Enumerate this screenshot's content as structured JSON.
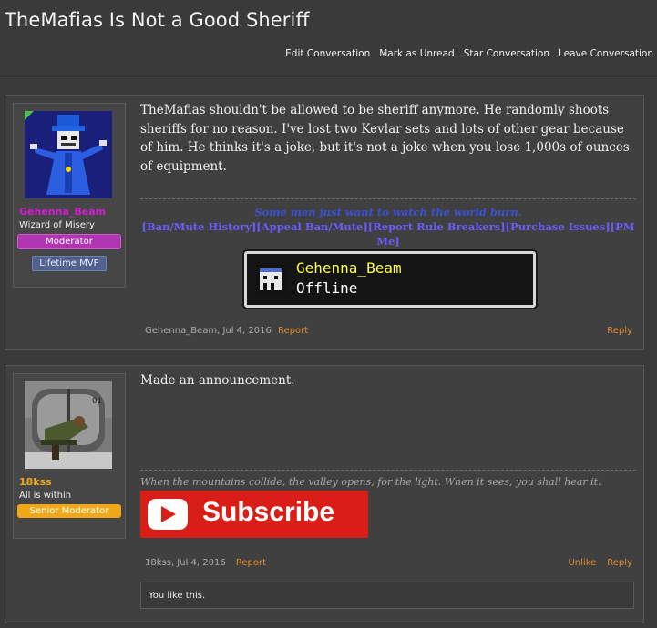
{
  "page": {
    "title": "TheMafias Is Not a Good Sheriff"
  },
  "actions": [
    "Edit Conversation",
    "Mark as Unread",
    "Star Conversation",
    "Leave Conversation"
  ],
  "posts": [
    {
      "user": {
        "name": "Gehenna_Beam",
        "name_color": "#d21fd2",
        "title": "Wizard of Misery",
        "role": "Moderator",
        "role_bg": "#b035b0",
        "extra_badge": "Lifetime MVP"
      },
      "message": "TheMafias shouldn't be allowed to be sheriff anymore. He randomly shoots sheriffs for no reason. I've lost two Kevlar sets and lots of other gear because of him. He thinks it's a joke, but it's not a joke when you lose 1,000s of ounces of equipment.",
      "signature": {
        "quote": "Some men just want to watch the world burn.",
        "links": [
          "[Ban/Mute History]",
          "[Appeal Ban/Mute]",
          "[Report Rule Breakers]",
          "[Purchase Issues]",
          "[PM Me]"
        ],
        "card_name": "Gehenna_Beam",
        "card_status": "Offline"
      },
      "meta": {
        "author": "Gehenna_Beam",
        "date": "Jul 4, 2016",
        "report": "Report",
        "reply": "Reply"
      }
    },
    {
      "user": {
        "name": "18kss",
        "name_color": "#f0a81a",
        "title": "All is within",
        "role": "Senior Moderator",
        "role_bg": "#f0a81a"
      },
      "message": "Made an announcement.",
      "signature": {
        "text": "When the mountains collide, the valley opens, for the light. When it sees, you shall hear it.",
        "subscribe": "Subscribe"
      },
      "meta": {
        "author": "18kss",
        "date": "Jul 4, 2016",
        "report": "Report",
        "unlike": "Unlike",
        "reply": "Reply"
      },
      "likes": "You like this."
    }
  ]
}
